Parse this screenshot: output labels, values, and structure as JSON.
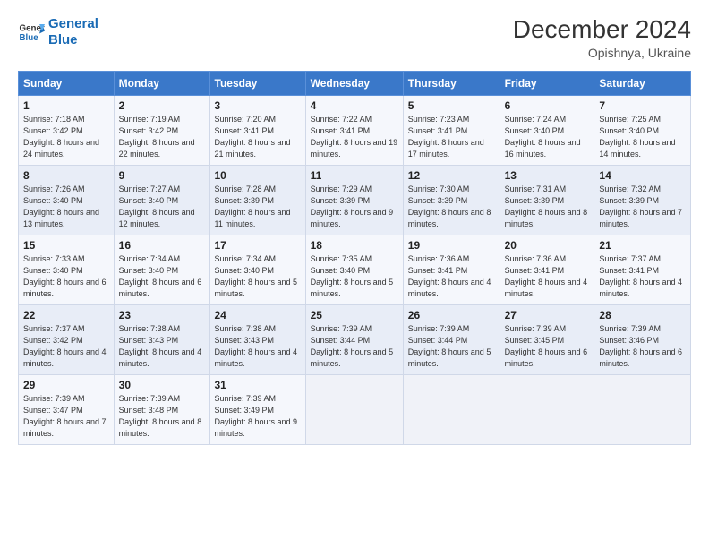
{
  "logo": {
    "line1": "General",
    "line2": "Blue"
  },
  "title": "December 2024",
  "subtitle": "Opishnya, Ukraine",
  "weekdays": [
    "Sunday",
    "Monday",
    "Tuesday",
    "Wednesday",
    "Thursday",
    "Friday",
    "Saturday"
  ],
  "weeks": [
    [
      {
        "day": "1",
        "sunrise": "7:18 AM",
        "sunset": "3:42 PM",
        "daylight": "8 hours and 24 minutes."
      },
      {
        "day": "2",
        "sunrise": "7:19 AM",
        "sunset": "3:42 PM",
        "daylight": "8 hours and 22 minutes."
      },
      {
        "day": "3",
        "sunrise": "7:20 AM",
        "sunset": "3:41 PM",
        "daylight": "8 hours and 21 minutes."
      },
      {
        "day": "4",
        "sunrise": "7:22 AM",
        "sunset": "3:41 PM",
        "daylight": "8 hours and 19 minutes."
      },
      {
        "day": "5",
        "sunrise": "7:23 AM",
        "sunset": "3:41 PM",
        "daylight": "8 hours and 17 minutes."
      },
      {
        "day": "6",
        "sunrise": "7:24 AM",
        "sunset": "3:40 PM",
        "daylight": "8 hours and 16 minutes."
      },
      {
        "day": "7",
        "sunrise": "7:25 AM",
        "sunset": "3:40 PM",
        "daylight": "8 hours and 14 minutes."
      }
    ],
    [
      {
        "day": "8",
        "sunrise": "7:26 AM",
        "sunset": "3:40 PM",
        "daylight": "8 hours and 13 minutes."
      },
      {
        "day": "9",
        "sunrise": "7:27 AM",
        "sunset": "3:40 PM",
        "daylight": "8 hours and 12 minutes."
      },
      {
        "day": "10",
        "sunrise": "7:28 AM",
        "sunset": "3:39 PM",
        "daylight": "8 hours and 11 minutes."
      },
      {
        "day": "11",
        "sunrise": "7:29 AM",
        "sunset": "3:39 PM",
        "daylight": "8 hours and 9 minutes."
      },
      {
        "day": "12",
        "sunrise": "7:30 AM",
        "sunset": "3:39 PM",
        "daylight": "8 hours and 8 minutes."
      },
      {
        "day": "13",
        "sunrise": "7:31 AM",
        "sunset": "3:39 PM",
        "daylight": "8 hours and 8 minutes."
      },
      {
        "day": "14",
        "sunrise": "7:32 AM",
        "sunset": "3:39 PM",
        "daylight": "8 hours and 7 minutes."
      }
    ],
    [
      {
        "day": "15",
        "sunrise": "7:33 AM",
        "sunset": "3:40 PM",
        "daylight": "8 hours and 6 minutes."
      },
      {
        "day": "16",
        "sunrise": "7:34 AM",
        "sunset": "3:40 PM",
        "daylight": "8 hours and 6 minutes."
      },
      {
        "day": "17",
        "sunrise": "7:34 AM",
        "sunset": "3:40 PM",
        "daylight": "8 hours and 5 minutes."
      },
      {
        "day": "18",
        "sunrise": "7:35 AM",
        "sunset": "3:40 PM",
        "daylight": "8 hours and 5 minutes."
      },
      {
        "day": "19",
        "sunrise": "7:36 AM",
        "sunset": "3:41 PM",
        "daylight": "8 hours and 4 minutes."
      },
      {
        "day": "20",
        "sunrise": "7:36 AM",
        "sunset": "3:41 PM",
        "daylight": "8 hours and 4 minutes."
      },
      {
        "day": "21",
        "sunrise": "7:37 AM",
        "sunset": "3:41 PM",
        "daylight": "8 hours and 4 minutes."
      }
    ],
    [
      {
        "day": "22",
        "sunrise": "7:37 AM",
        "sunset": "3:42 PM",
        "daylight": "8 hours and 4 minutes."
      },
      {
        "day": "23",
        "sunrise": "7:38 AM",
        "sunset": "3:43 PM",
        "daylight": "8 hours and 4 minutes."
      },
      {
        "day": "24",
        "sunrise": "7:38 AM",
        "sunset": "3:43 PM",
        "daylight": "8 hours and 4 minutes."
      },
      {
        "day": "25",
        "sunrise": "7:39 AM",
        "sunset": "3:44 PM",
        "daylight": "8 hours and 5 minutes."
      },
      {
        "day": "26",
        "sunrise": "7:39 AM",
        "sunset": "3:44 PM",
        "daylight": "8 hours and 5 minutes."
      },
      {
        "day": "27",
        "sunrise": "7:39 AM",
        "sunset": "3:45 PM",
        "daylight": "8 hours and 6 minutes."
      },
      {
        "day": "28",
        "sunrise": "7:39 AM",
        "sunset": "3:46 PM",
        "daylight": "8 hours and 6 minutes."
      }
    ],
    [
      {
        "day": "29",
        "sunrise": "7:39 AM",
        "sunset": "3:47 PM",
        "daylight": "8 hours and 7 minutes."
      },
      {
        "day": "30",
        "sunrise": "7:39 AM",
        "sunset": "3:48 PM",
        "daylight": "8 hours and 8 minutes."
      },
      {
        "day": "31",
        "sunrise": "7:39 AM",
        "sunset": "3:49 PM",
        "daylight": "8 hours and 9 minutes."
      },
      null,
      null,
      null,
      null
    ]
  ]
}
